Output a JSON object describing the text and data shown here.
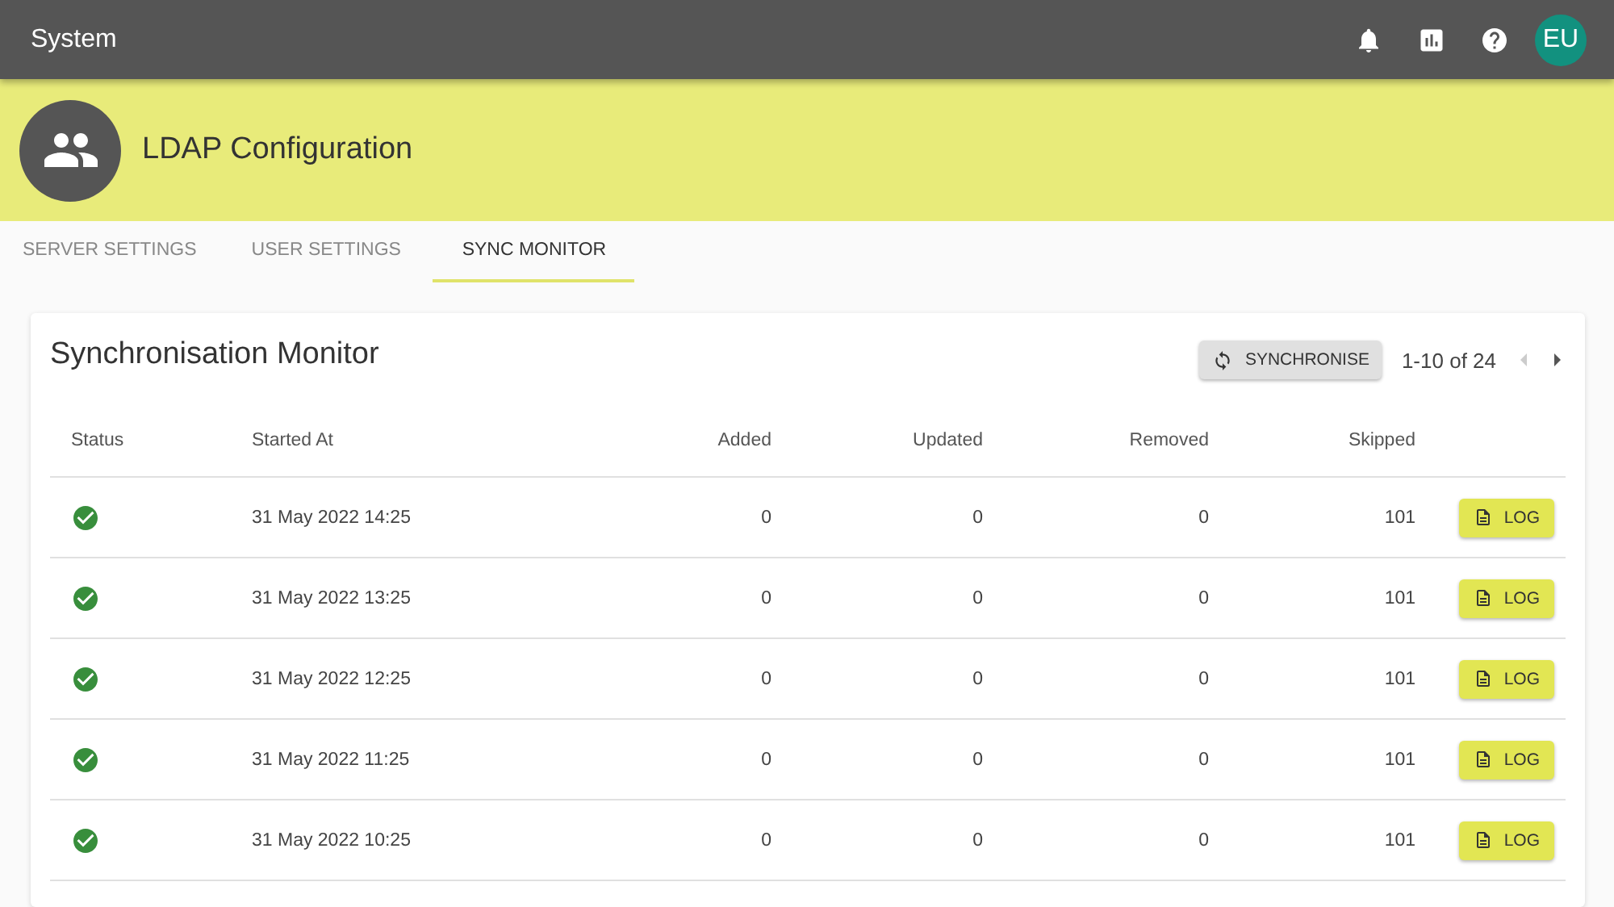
{
  "app_bar": {
    "title": "System",
    "avatar": "EU"
  },
  "banner": {
    "title": "LDAP Configuration"
  },
  "tabs": [
    {
      "label": "SERVER SETTINGS",
      "selected": false
    },
    {
      "label": "USER SETTINGS",
      "selected": false
    },
    {
      "label": "SYNC MONITOR",
      "selected": true
    }
  ],
  "card": {
    "title": "Synchronisation Monitor",
    "sync_button": "SYNCHRONISE",
    "pagination": "1-10 of 24"
  },
  "table": {
    "columns": [
      "Status",
      "Started At",
      "Added",
      "Updated",
      "Removed",
      "Skipped"
    ],
    "rows": [
      {
        "succeeded": true,
        "started_at": "31 May 2022 14:25",
        "added": "0",
        "updated": "0",
        "removed": "0",
        "skipped": "101",
        "action": "LOG"
      },
      {
        "succeeded": true,
        "started_at": "31 May 2022 13:25",
        "added": "0",
        "updated": "0",
        "removed": "0",
        "skipped": "101",
        "action": "LOG"
      },
      {
        "succeeded": true,
        "started_at": "31 May 2022 12:25",
        "added": "0",
        "updated": "0",
        "removed": "0",
        "skipped": "101",
        "action": "LOG"
      },
      {
        "succeeded": true,
        "started_at": "31 May 2022 11:25",
        "added": "0",
        "updated": "0",
        "removed": "0",
        "skipped": "101",
        "action": "LOG"
      },
      {
        "succeeded": true,
        "started_at": "31 May 2022 10:25",
        "added": "0",
        "updated": "0",
        "removed": "0",
        "skipped": "101",
        "action": "LOG"
      }
    ]
  }
}
